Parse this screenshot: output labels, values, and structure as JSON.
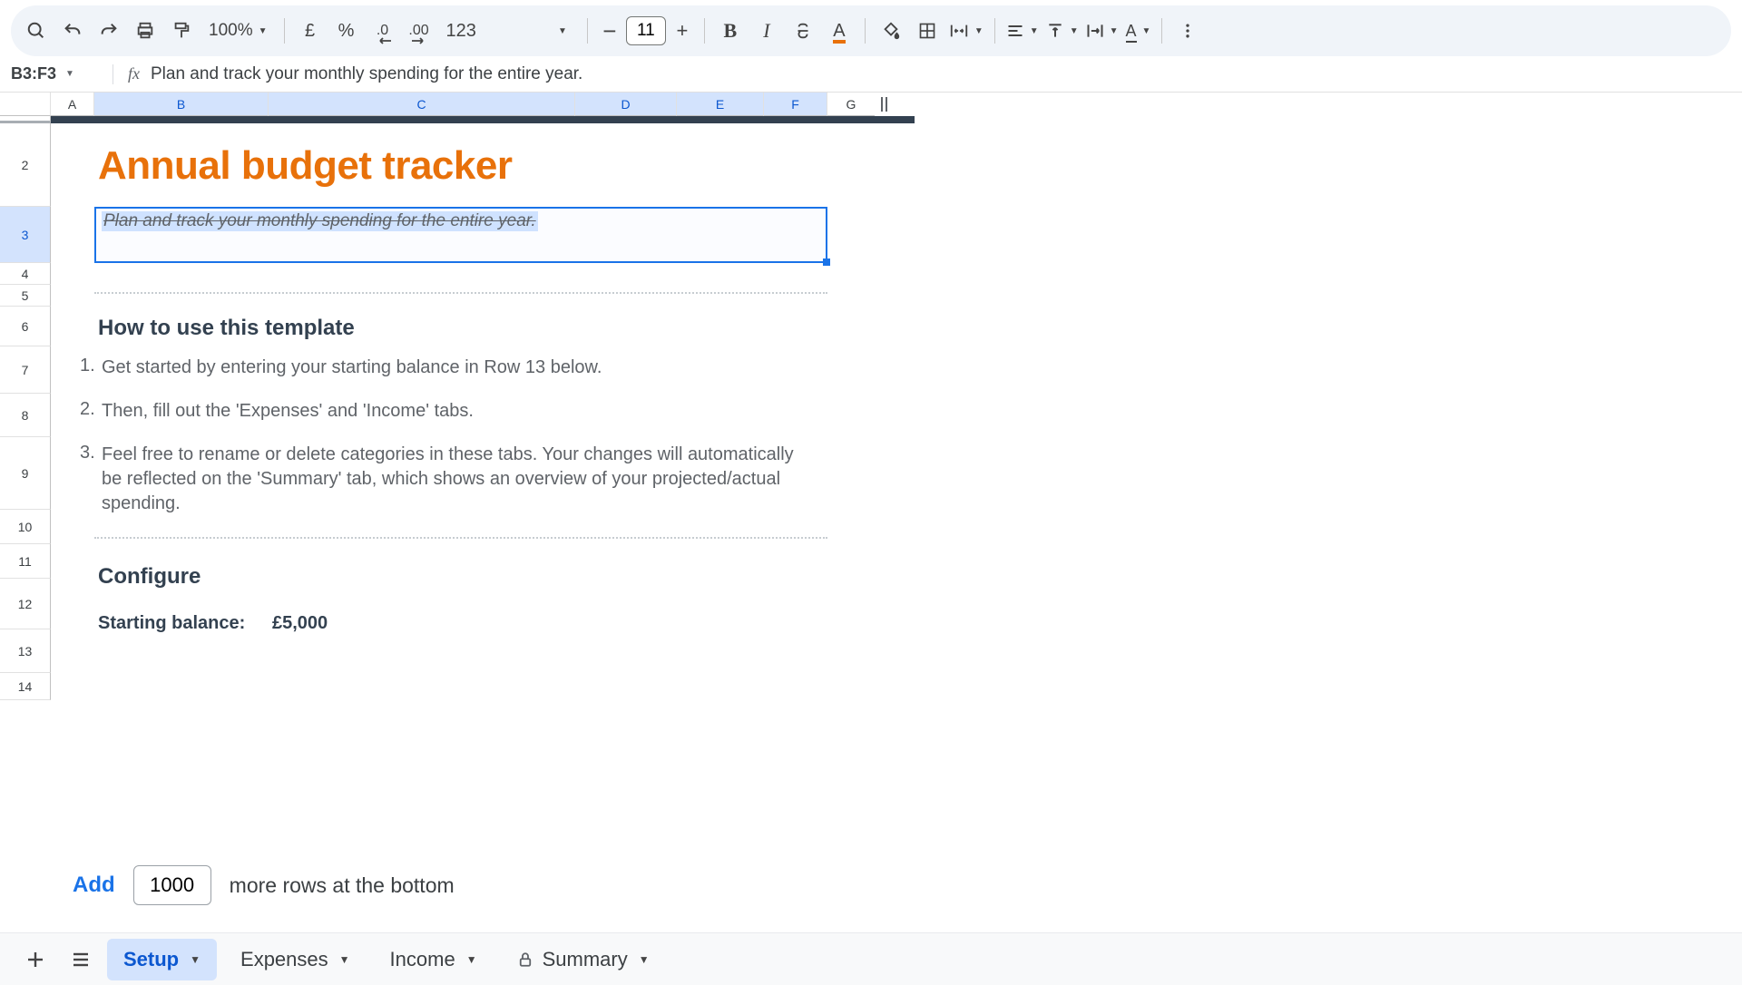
{
  "toolbar": {
    "zoom": "100%",
    "currency": "£",
    "percent": "%",
    "dec_decrease": ".0",
    "dec_increase": ".00",
    "num123": "123",
    "font_size": "11",
    "bold": "B",
    "italic": "I"
  },
  "formula_bar": {
    "name_box": "B3:F3",
    "fx": "fx",
    "content": "Plan and track your monthly spending for the entire year."
  },
  "columns": [
    "A",
    "B",
    "C",
    "D",
    "E",
    "F",
    "G"
  ],
  "rows": [
    "2",
    "3",
    "4",
    "5",
    "6",
    "7",
    "8",
    "9",
    "10",
    "11",
    "12",
    "13",
    "14"
  ],
  "sheet": {
    "title": "Annual budget tracker",
    "subtitle": "Plan and track your monthly spending for the entire year.",
    "howto_heading": "How to use this template",
    "steps": [
      {
        "num": "1.",
        "text": "Get started by entering your starting balance in Row 13 below."
      },
      {
        "num": "2.",
        "text": "Then, fill out the 'Expenses' and 'Income' tabs."
      },
      {
        "num": "3.",
        "text": "Feel free to rename or delete categories in these tabs. Your changes will automatically be reflected on the 'Summary' tab, which shows an overview of your projected/actual spending."
      }
    ],
    "configure_heading": "Configure",
    "starting_balance_label": "Starting balance:",
    "starting_balance_value": "£5,000"
  },
  "add_rows": {
    "button": "Add",
    "count": "1000",
    "suffix": "more rows at the bottom"
  },
  "tabs": {
    "setup": "Setup",
    "expenses": "Expenses",
    "income": "Income",
    "summary": "Summary"
  }
}
